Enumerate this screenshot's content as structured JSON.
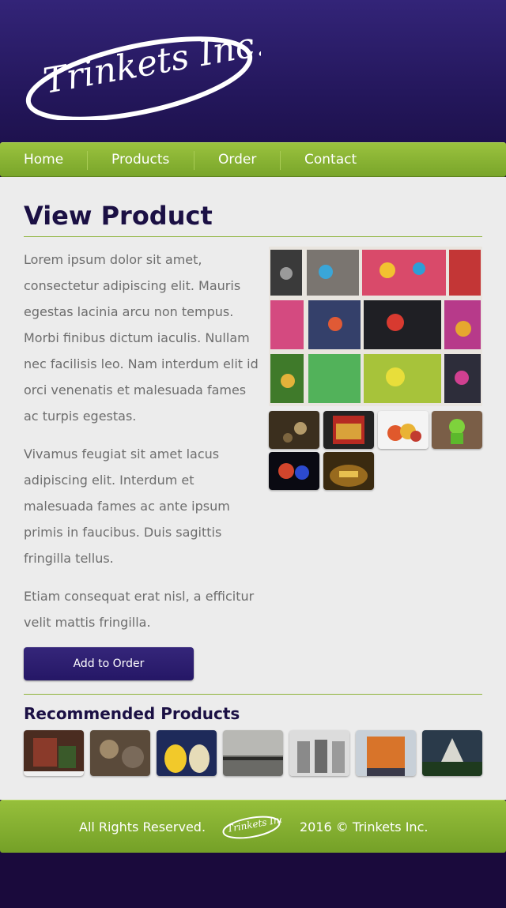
{
  "brand": {
    "logo_text": "Trinkets Inc."
  },
  "nav": {
    "items": [
      "Home",
      "Products",
      "Order",
      "Contact"
    ]
  },
  "main": {
    "title": "View Product",
    "paragraphs": [
      "Lorem ipsum dolor sit amet, consectetur adipiscing elit. Mauris egestas lacinia arcu non tempus. Morbi finibus dictum iaculis. Nullam nec facilisis leo. Nam interdum elit id orci venenatis et malesuada fames ac turpis egestas.",
      "Vivamus feugiat sit amet lacus adipiscing elit. Interdum et malesuada fames ac ante ipsum primis in faucibus. Duis sagittis fringilla tellus.",
      "Etiam consequat erat nisl, a efficitur velit mattis fringilla."
    ],
    "add_button": "Add to Order",
    "gallery_thumbs": [
      "lights-thumb",
      "gi-joe-box-thumb",
      "colorful-toys-thumb",
      "green-figure-thumb",
      "dark-toys-thumb",
      "gold-figures-thumb"
    ]
  },
  "recommended": {
    "title": "Recommended Products",
    "items": [
      "robot-toy",
      "steampunk-trinket",
      "yellow-ducks",
      "grey-landscape",
      "soldier-figures",
      "orange-blocks",
      "castle"
    ]
  },
  "footer": {
    "left": "All Rights Reserved.",
    "right": "2016 © Trinkets Inc."
  },
  "colors": {
    "header": "#2a1c6a",
    "nav": "#8bb634",
    "title": "#1b1044",
    "text": "#6d6d6d",
    "button": "#2d1f72"
  }
}
